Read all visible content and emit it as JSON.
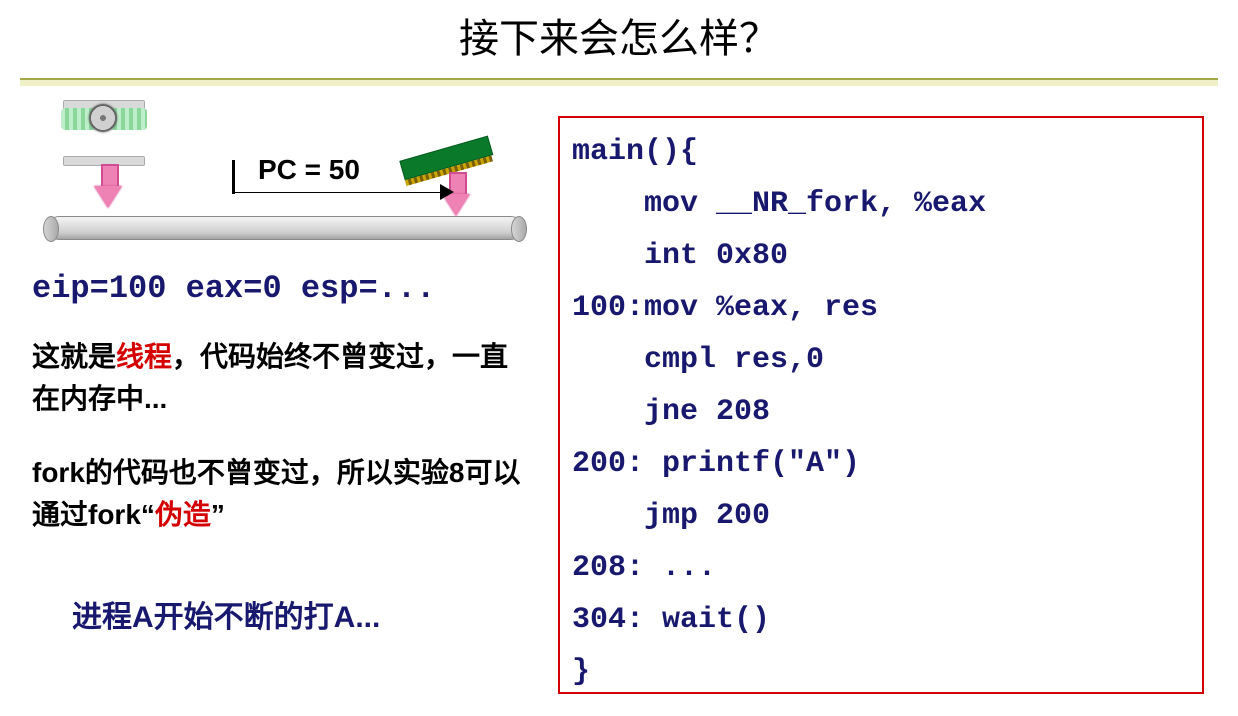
{
  "title": "接下来会怎么样？",
  "diagram": {
    "pc_label": "PC = 50"
  },
  "registers": "eip=100 eax=0 esp=...",
  "para1": {
    "t1": "这就是",
    "thread": "线程",
    "t2": "，代码始终不曾变过，一直在内存中..."
  },
  "para2": {
    "t1": "fork的代码也不曾变过，所以实验8可以通过fork“",
    "forge": "伪造",
    "t2": "”"
  },
  "conclusion": "进程A开始不断的打A...",
  "code": "main(){\n    mov __NR_fork, %eax\n    int 0x80\n100:mov %eax, res\n    cmpl res,0\n    jne 208\n200: printf(\"A\")\n    jmp 200\n208: ...\n304: wait()\n}"
}
